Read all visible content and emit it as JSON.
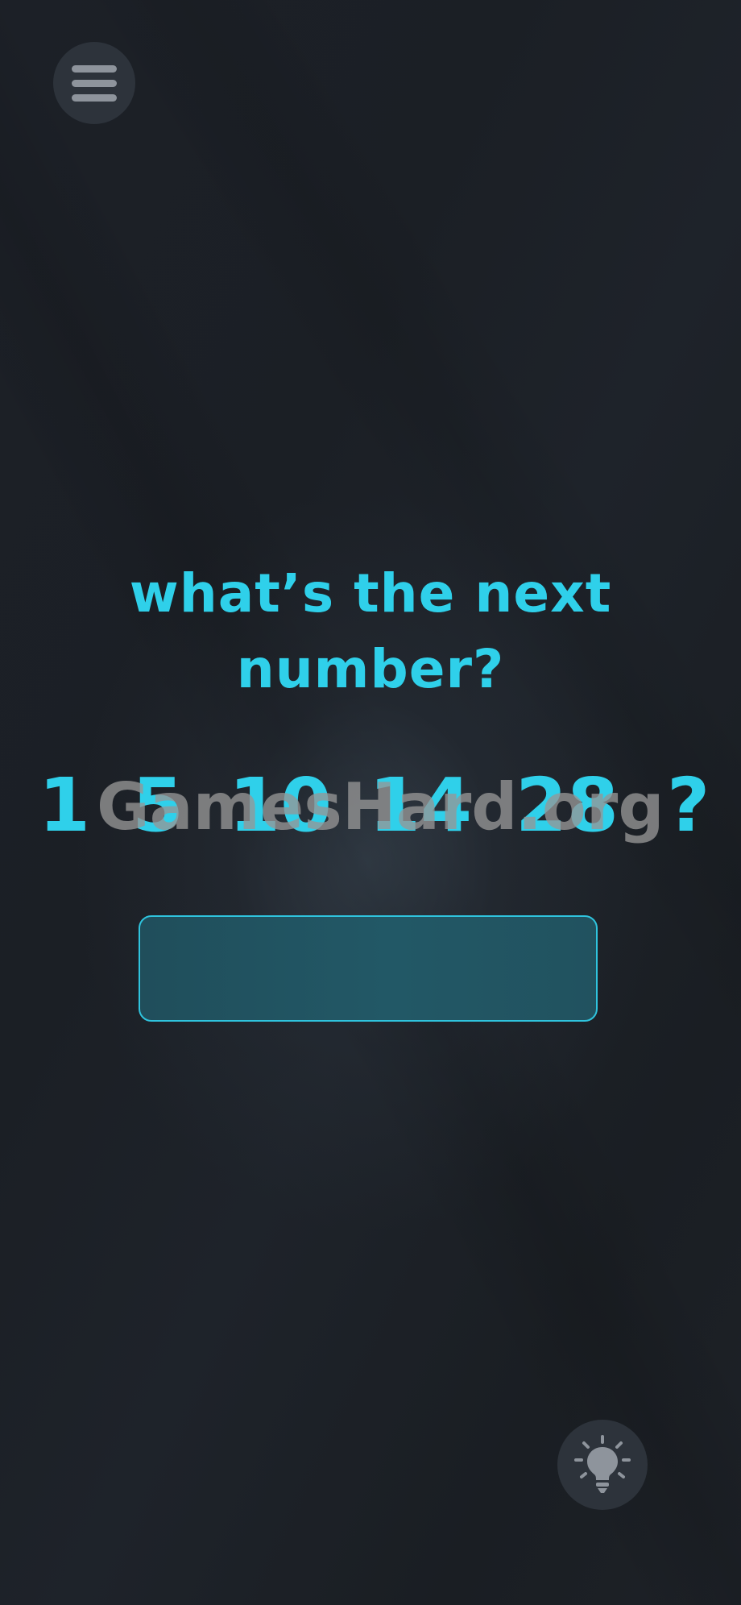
{
  "header": {
    "menu_icon": "hamburger-menu-icon"
  },
  "puzzle": {
    "question": "what’s the next number?",
    "sequence": [
      "1",
      "5",
      "10",
      "14",
      "28",
      "?"
    ]
  },
  "answer": {
    "value": "",
    "placeholder": ""
  },
  "watermark": "GamesHard.org",
  "footer": {
    "hint_icon": "lightbulb-icon"
  },
  "colors": {
    "accent": "#2fd0ea",
    "background": "#1c2027",
    "button_bg": "#2d333b",
    "answer_fill": "#225866"
  }
}
